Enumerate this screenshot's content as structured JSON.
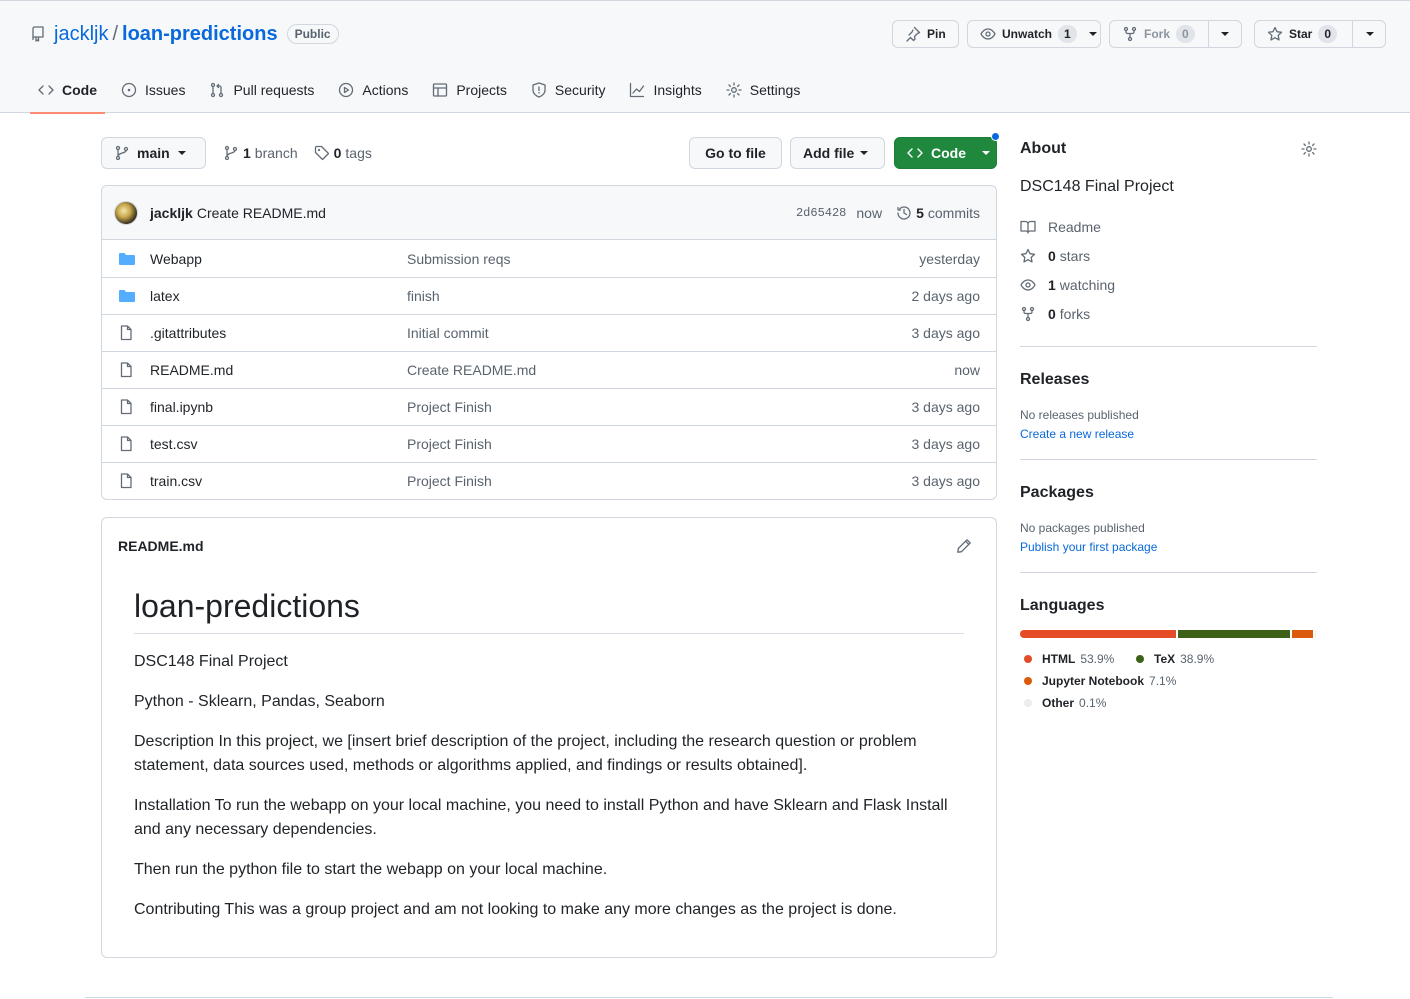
{
  "repo": {
    "owner": "jackljk",
    "name": "loan-predictions",
    "visibility": "Public"
  },
  "actions": {
    "pin": "Pin",
    "unwatch": "Unwatch",
    "watch_count": "1",
    "fork": "Fork",
    "fork_count": "0",
    "star": "Star",
    "star_count": "0"
  },
  "tabs": [
    {
      "label": "Code",
      "icon": "code-icon"
    },
    {
      "label": "Issues",
      "icon": "issue-icon"
    },
    {
      "label": "Pull requests",
      "icon": "pull-request-icon"
    },
    {
      "label": "Actions",
      "icon": "play-icon"
    },
    {
      "label": "Projects",
      "icon": "table-icon"
    },
    {
      "label": "Security",
      "icon": "shield-icon"
    },
    {
      "label": "Insights",
      "icon": "graph-icon"
    },
    {
      "label": "Settings",
      "icon": "gear-icon"
    }
  ],
  "toolbar": {
    "branch": "main",
    "branch_count": "1",
    "branch_label": "branch",
    "tag_count": "0",
    "tag_label": "tags",
    "go_to_file": "Go to file",
    "add_file": "Add file",
    "code": "Code"
  },
  "latest_commit": {
    "author": "jackljk",
    "message": "Create README.md",
    "sha": "2d65428",
    "time": "now",
    "commit_count": "5",
    "commit_label": "commits"
  },
  "files": [
    {
      "type": "dir",
      "name": "Webapp",
      "message": "Submission reqs",
      "age": "yesterday"
    },
    {
      "type": "dir",
      "name": "latex",
      "message": "finish",
      "age": "2 days ago"
    },
    {
      "type": "file",
      "name": ".gitattributes",
      "message": "Initial commit",
      "age": "3 days ago"
    },
    {
      "type": "file",
      "name": "README.md",
      "message": "Create README.md",
      "age": "now"
    },
    {
      "type": "file",
      "name": "final.ipynb",
      "message": "Project Finish",
      "age": "3 days ago"
    },
    {
      "type": "file",
      "name": "test.csv",
      "message": "Project Finish",
      "age": "3 days ago"
    },
    {
      "type": "file",
      "name": "train.csv",
      "message": "Project Finish",
      "age": "3 days ago"
    }
  ],
  "readme": {
    "filename": "README.md",
    "title": "loan-predictions",
    "paragraphs": [
      "DSC148 Final Project",
      "Python - Sklearn, Pandas, Seaborn",
      "Description In this project, we [insert brief description of the project, including the research question or problem statement, data sources used, methods or algorithms applied, and findings or results obtained].",
      "Installation To run the webapp on your local machine, you need to install Python and have Sklearn and Flask Install and any necessary dependencies.",
      "Then run the python file to start the webapp on your local machine.",
      "Contributing This was a group project and am not looking to make any more changes as the project is done."
    ]
  },
  "sidebar": {
    "about_title": "About",
    "description": "DSC148 Final Project",
    "readme_label": "Readme",
    "stars_count": "0",
    "stars_label": "stars",
    "watching_count": "1",
    "watching_label": "watching",
    "forks_count": "0",
    "forks_label": "forks",
    "releases_title": "Releases",
    "releases_none": "No releases published",
    "releases_link": "Create a new release",
    "packages_title": "Packages",
    "packages_none": "No packages published",
    "packages_link": "Publish your first package",
    "languages_title": "Languages"
  },
  "languages": [
    {
      "name": "HTML",
      "percent": "53.9%",
      "value": 53.9,
      "color": "#e34c26"
    },
    {
      "name": "TeX",
      "percent": "38.9%",
      "value": 38.9,
      "color": "#3d6117"
    },
    {
      "name": "Jupyter Notebook",
      "percent": "7.1%",
      "value": 7.1,
      "color": "#da5b0b"
    },
    {
      "name": "Other",
      "percent": "0.1%",
      "value": 0.1,
      "color": "#ededed"
    }
  ],
  "colors": {
    "link": "#0969da",
    "primary_button": "#1f883d",
    "tab_underline": "#fd8c73"
  }
}
